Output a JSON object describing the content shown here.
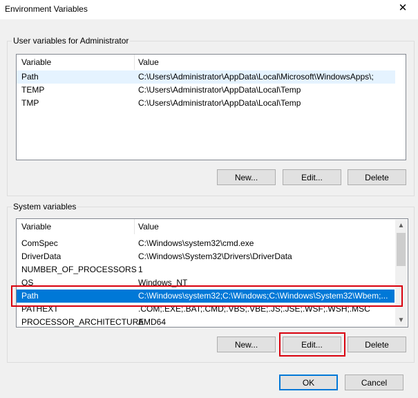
{
  "window": {
    "title": "Environment Variables",
    "close_glyph": "✕"
  },
  "user_vars": {
    "group_label": "User variables for Administrator",
    "columns": [
      "Variable",
      "Value"
    ],
    "rows": [
      {
        "name": "Path",
        "value": "C:\\Users\\Administrator\\AppData\\Local\\Microsoft\\WindowsApps\\;"
      },
      {
        "name": "TEMP",
        "value": "C:\\Users\\Administrator\\AppData\\Local\\Temp"
      },
      {
        "name": "TMP",
        "value": "C:\\Users\\Administrator\\AppData\\Local\\Temp"
      }
    ],
    "buttons": {
      "new": "New...",
      "edit": "Edit...",
      "delete": "Delete"
    }
  },
  "system_vars": {
    "group_label": "System variables",
    "columns": [
      "Variable",
      "Value"
    ],
    "rows": [
      {
        "name": "ComSpec",
        "value": "C:\\Windows\\system32\\cmd.exe"
      },
      {
        "name": "DriverData",
        "value": "C:\\Windows\\System32\\Drivers\\DriverData"
      },
      {
        "name": "NUMBER_OF_PROCESSORS",
        "value": "1"
      },
      {
        "name": "OS",
        "value": "Windows_NT"
      },
      {
        "name": "Path",
        "value": "C:\\Windows\\system32;C:\\Windows;C:\\Windows\\System32\\Wbem;..."
      },
      {
        "name": "PATHEXT",
        "value": ".COM;.EXE;.BAT;.CMD;.VBS;.VBE;.JS;.JSE;.WSF;.WSH;.MSC"
      },
      {
        "name": "PROCESSOR_ARCHITECTURE",
        "value": "AMD64"
      }
    ],
    "selected_index": 4,
    "buttons": {
      "new": "New...",
      "edit": "Edit...",
      "delete": "Delete"
    }
  },
  "dialog_buttons": {
    "ok": "OK",
    "cancel": "Cancel"
  },
  "icons": {
    "scroll_up": "▲",
    "scroll_down": "▼"
  },
  "colors": {
    "selection": "#0078d7",
    "highlight_box": "#d9000d"
  }
}
